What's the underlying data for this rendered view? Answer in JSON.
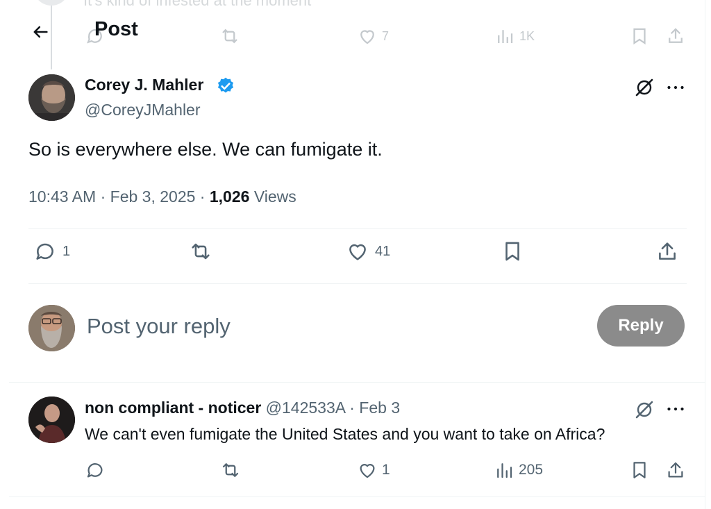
{
  "header": {
    "title": "Post",
    "back_label": "Back"
  },
  "ghost_tweet": {
    "text": "It's kind of infested at the moment",
    "likes": "7",
    "views": "1K"
  },
  "main_tweet": {
    "author_name": "Corey J. Mahler",
    "author_handle": "@CoreyJMahler",
    "text": "So is everywhere else. We can fumigate it.",
    "time": "10:43 AM",
    "date": "Feb 3, 2025",
    "views_count": "1,026",
    "views_label": "Views",
    "replies": "1",
    "likes": "41"
  },
  "reply_box": {
    "placeholder": "Post your reply",
    "button_label": "Reply"
  },
  "reply_tweet": {
    "author_name": "non compliant - noticer",
    "author_handle": "@142533A",
    "date": "Feb 3",
    "text": "We can't even fumigate the United States and you want to take on Africa?",
    "likes": "1",
    "views": "205"
  },
  "colors": {
    "verified_blue": "#1d9bf0",
    "text_primary": "#0f1419",
    "text_secondary": "#536471",
    "reply_button_bg": "#8b8b8b",
    "divider": "#eff3f4"
  },
  "icons": {
    "back": "arrow-left-icon",
    "verified": "verified-badge-icon",
    "grok": "grok-icon",
    "more": "more-horizontal-icon",
    "reply": "reply-icon",
    "repost": "repost-icon",
    "like": "heart-icon",
    "bookmark": "bookmark-icon",
    "share": "share-icon",
    "views": "views-icon"
  }
}
